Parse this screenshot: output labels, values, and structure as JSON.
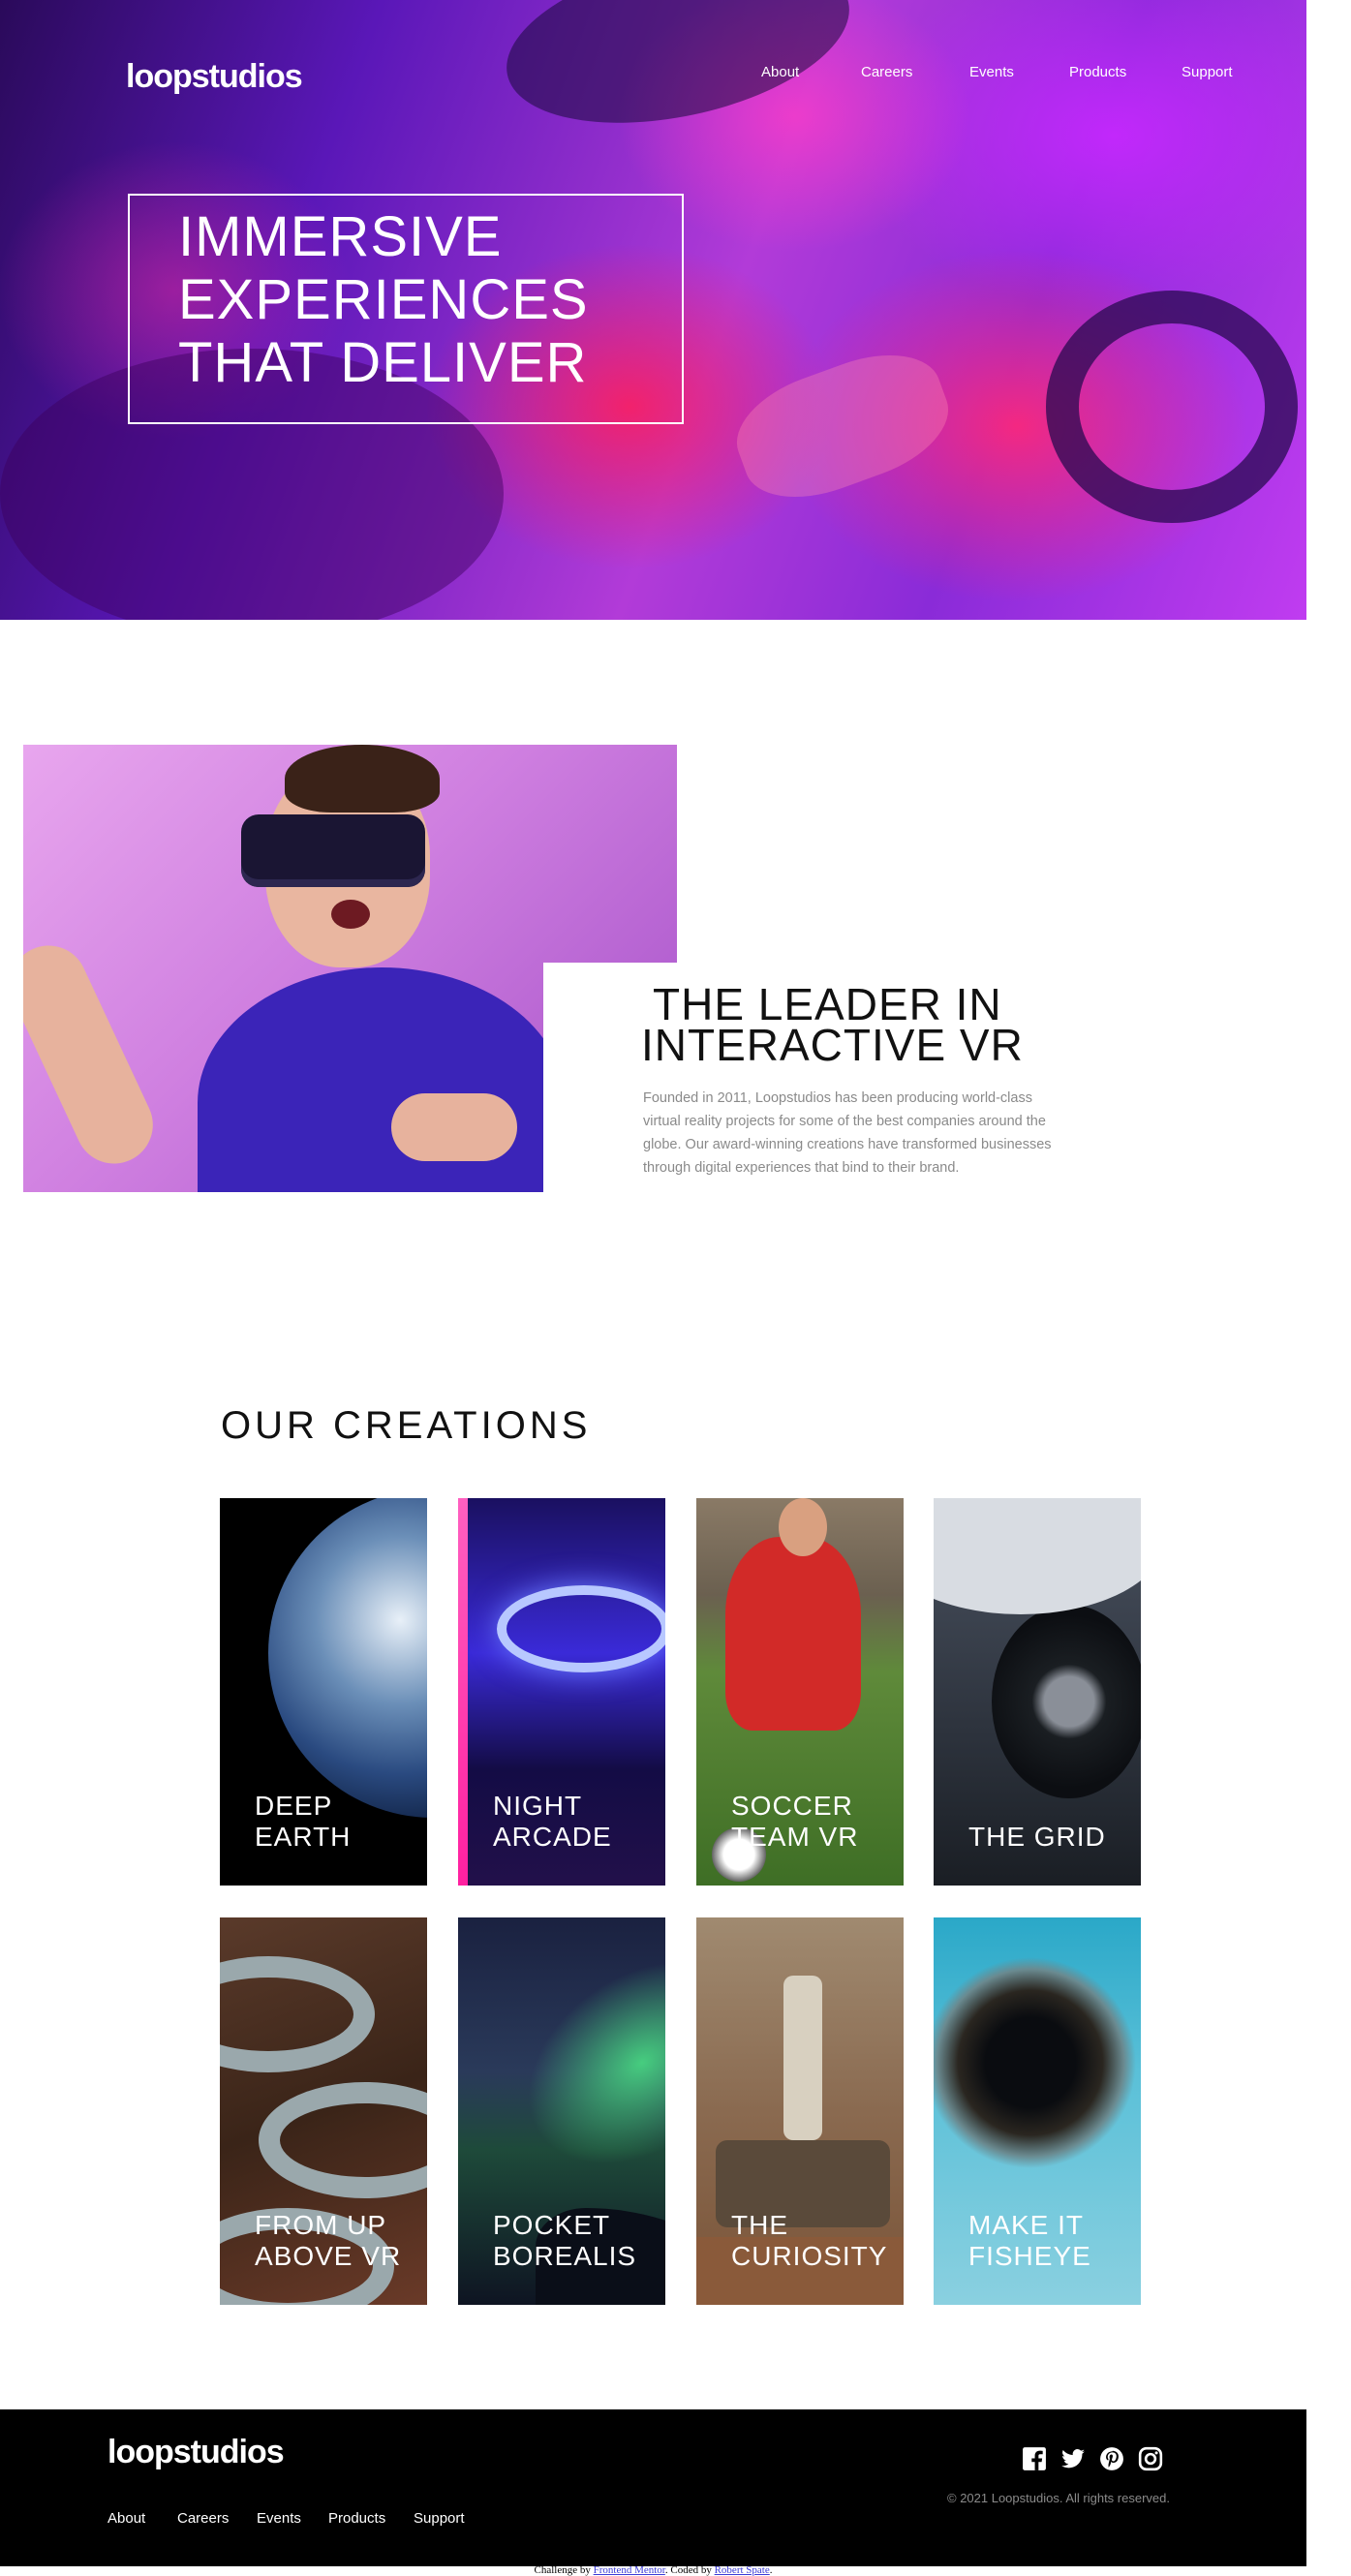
{
  "brand": {
    "logo": "loopstudios"
  },
  "nav": {
    "items": [
      "About",
      "Careers",
      "Events",
      "Products",
      "Support"
    ]
  },
  "hero": {
    "title_lines": [
      "IMMERSIVE",
      "EXPERIENCES",
      "THAT DELIVER"
    ]
  },
  "about": {
    "title_lines": [
      "THE LEADER IN",
      "INTERACTIVE VR"
    ],
    "text": "Founded in 2011, Loopstudios has been producing world-class virtual reality projects for some of the best companies around the globe. Our award-winning creations have transformed businesses through digital experiences that bind to their brand."
  },
  "creations": {
    "title": "OUR CREATIONS",
    "items": [
      {
        "lines": [
          "DEEP",
          "EARTH"
        ]
      },
      {
        "lines": [
          "NIGHT",
          "ARCADE"
        ]
      },
      {
        "lines": [
          "SOCCER",
          "TEAM VR"
        ]
      },
      {
        "lines": [
          "THE GRID"
        ]
      },
      {
        "lines": [
          "FROM UP",
          "ABOVE VR"
        ]
      },
      {
        "lines": [
          "POCKET",
          "BOREALIS"
        ]
      },
      {
        "lines": [
          "THE",
          "CURIOSITY"
        ]
      },
      {
        "lines": [
          "MAKE IT",
          "FISHEYE"
        ]
      }
    ]
  },
  "footer": {
    "logo": "loopstudios",
    "copyright": "© 2021 Loopstudios. All rights reserved.",
    "socials": [
      "facebook-icon",
      "twitter-icon",
      "pinterest-icon",
      "instagram-icon"
    ]
  },
  "attribution": {
    "prefix": "Challenge by ",
    "challenge_link": "Frontend Mentor",
    "middle": ". Coded by ",
    "author_link": "Robert Spate",
    "suffix": "."
  }
}
